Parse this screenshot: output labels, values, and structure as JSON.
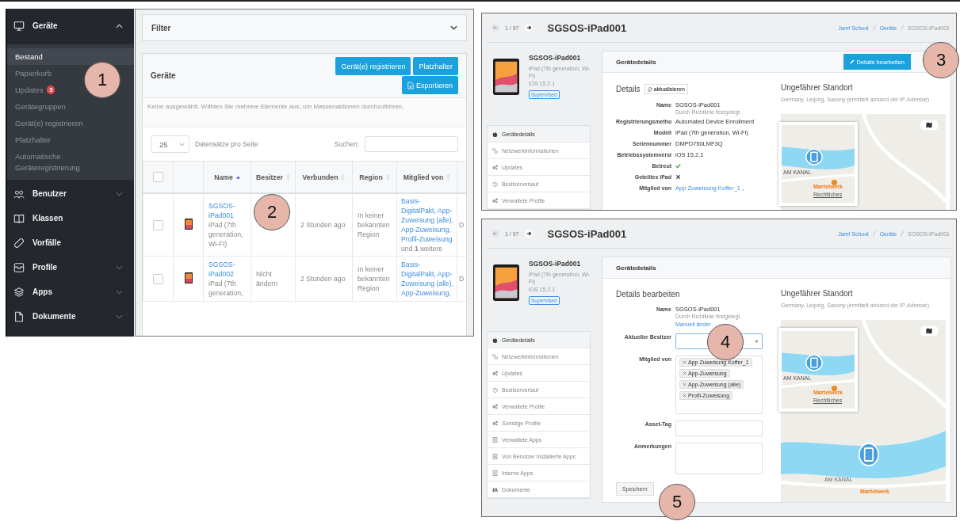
{
  "callouts": [
    "1",
    "2",
    "3",
    "4",
    "5"
  ],
  "sidebar": {
    "items": [
      {
        "label": "Geräte",
        "expandable": true,
        "expanded": true,
        "children": [
          {
            "label": "Bestand",
            "selected": true
          },
          {
            "label": "Papierkorb",
            "selected": false
          },
          {
            "label": "Updates",
            "selected": false,
            "badge": "5"
          },
          {
            "label": "Gerätegruppen",
            "selected": false
          },
          {
            "label": "Gerät(e) registrieren",
            "selected": false
          },
          {
            "label": "Platzhalter",
            "selected": false
          },
          {
            "label": "Automatische Geräteregistrierung",
            "selected": false
          }
        ]
      },
      {
        "label": "Benutzer",
        "expandable": true,
        "expanded": false
      },
      {
        "label": "Klassen",
        "expandable": false
      },
      {
        "label": "Vorfälle",
        "expandable": false
      },
      {
        "label": "Profile",
        "expandable": true,
        "expanded": false
      },
      {
        "label": "Apps",
        "expandable": true,
        "expanded": false
      },
      {
        "label": "Dokumente",
        "expandable": true,
        "expanded": false
      }
    ]
  },
  "devices": {
    "filter": "Filter",
    "title": "Geräte",
    "buttons": [
      "Gerät(e) registrieren",
      "Platzhalter",
      "Exportieren"
    ],
    "notice": "Keine ausgewählt. Wählen Sie mehrere Elemente aus, um Massenaktionen durchzuführen.",
    "page_size": "25",
    "page_size_label": "Datensätze pro Seite",
    "search_label": "Suchen:",
    "select_all_checked": false,
    "columns": [
      {
        "label": "Name",
        "sorted": true
      },
      {
        "label": "Besitzer",
        "sorted": false
      },
      {
        "label": "Verbunden",
        "sorted": false
      },
      {
        "label": "Region",
        "sorted": false
      },
      {
        "label": "Mitglied von",
        "sorted": false
      }
    ],
    "rows": [
      {
        "checked": false,
        "name": "SGSOS-iPad001",
        "model": "iPad (7th generation, Wi-Fi)",
        "connected": "2 Stunden ago",
        "region": "In keiner bekannten Region",
        "groups": "Basis-DigitalPakt, App-Zuweisung (alle), App-Zuweisung, Profil-Zuweisung",
        "groups_more": "und **1** weitere",
        "column_7": "D"
      },
      {
        "checked": false,
        "name": "SGSOS-iPad002",
        "model": "iPad (7th generation,",
        "owner": "Nicht ändern",
        "connected": "2 Stunden ago",
        "region": "In keiner bekannten Region",
        "groups": "Basis-DigitalPakt, App-Zuweisung (alle), App-Zuweisung,",
        "column_7": "D"
      }
    ]
  },
  "detail_views": [
    {
      "pager": "1 / 97",
      "title": "SGSOS-iPad001",
      "breadcrumbs": [
        "Jamf School",
        "Geräte",
        "SGSOS-iPad001"
      ],
      "device": {
        "name": "SGSOS-iPad001",
        "model": "iPad (7th generation, Wi-Fi)",
        "os": "iOS 15.2.1",
        "badge": "Supervised"
      },
      "nav": [
        {
          "label": "Gerätedetails",
          "selected": true
        },
        {
          "label": "Netzwerkinformationen",
          "selected": false
        },
        {
          "label": "Updates",
          "selected": false
        },
        {
          "label": "Besitzerverlauf",
          "selected": false
        },
        {
          "label": "Verwaltete Profile",
          "selected": false
        }
      ],
      "card_title": "Gerätedetails",
      "card_button": "Details bearbeiten",
      "section_title": "Details",
      "section_button": "aktualisieren",
      "fields": [
        {
          "kind": "text",
          "label": "Name",
          "value": "SGSOS-iPad001",
          "note": "Durch Richtlinie festgelegt."
        },
        {
          "kind": "text",
          "label": "Registrierungsmetho",
          "value": "Automated Device Enrollment"
        },
        {
          "kind": "text",
          "label": "Modell",
          "value": "iPad (7th generation, Wi-Fi)"
        },
        {
          "kind": "text",
          "label": "Seriennummer",
          "value": "DMPD750LMF3Q"
        },
        {
          "kind": "text",
          "label": "Betriebssystemversi",
          "value": "iOS 15.2.1"
        },
        {
          "kind": "check",
          "label": "Betreut",
          "checked": true
        },
        {
          "kind": "check",
          "label": "Geteiltes iPad",
          "checked": false
        },
        {
          "kind": "link",
          "label": "Mitglied von",
          "value": "App Zuweisung Koffer_1",
          "suffix": ","
        }
      ],
      "location_title": "Ungefährer Standort",
      "location_text": "Germany, Leipzig, Saxony (ermittelt anhand der IP-Adresse)",
      "map_popup": {
        "street": "AM KANAL",
        "place": "Mørtelwerk",
        "link": "Rechtliches"
      }
    },
    {
      "pager": "1 / 97",
      "title": "SGSOS-iPad001",
      "breadcrumbs": [
        "Jamf School",
        "Geräte",
        "SGSOS-iPad001"
      ],
      "device": {
        "name": "SGSOS-iPad001",
        "model": "iPad (7th generation, Wi-Fi)",
        "os": "iOS 15.2.1",
        "badge": "Supervised"
      },
      "nav": [
        {
          "label": "Gerätedetails",
          "selected": true
        },
        {
          "label": "Netzwerkinformationen",
          "selected": false
        },
        {
          "label": "Updates",
          "selected": false
        },
        {
          "label": "Besitzerverlauf",
          "selected": false
        },
        {
          "label": "Verwaltete Profile",
          "selected": false
        },
        {
          "label": "Sonstige Profile",
          "selected": false
        },
        {
          "label": "Verwaltete Apps",
          "selected": false
        },
        {
          "label": "Von Benutzer installierte Apps",
          "selected": false
        },
        {
          "label": "Interne Apps",
          "selected": false
        },
        {
          "label": "Dokumente",
          "selected": false
        }
      ],
      "card_title": "Gerätedetails",
      "section_title": "Details bearbeiten",
      "fields": [
        {
          "kind": "text",
          "label": "Name",
          "value": "SGSOS-iPad001",
          "note": "Durch Richtlinie festgelegt.",
          "link": "Manuell änder"
        },
        {
          "kind": "select",
          "label": "Aktueller Besitzer"
        },
        {
          "kind": "tags",
          "label": "Mitglied von",
          "tags": [
            "App Zuweisung Koffer_1",
            "App-Zuweisung",
            "App-Zuweisung (alle)",
            "Profil-Zuweisung"
          ]
        },
        {
          "kind": "input",
          "label": "Asset-Tag"
        },
        {
          "kind": "textarea",
          "label": "Anmerkungen"
        }
      ],
      "save_button": "Speichern",
      "location_title": "Ungefährer Standort",
      "location_text": "Germany, Leipzig, Saxony (ermittelt anhand der IP-Adresse)",
      "map_popup": {
        "street": "AM KANAL",
        "place": "Mørtelwerk",
        "link": "Rechtliches"
      },
      "map_labels": {
        "street": "AM KANAL",
        "place": "Mørtelwerk"
      }
    }
  ]
}
